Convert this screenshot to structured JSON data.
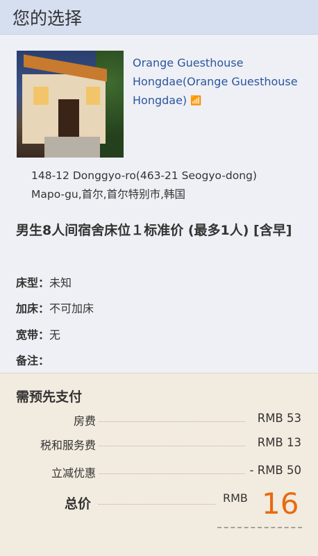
{
  "header": {
    "title": "您的选择"
  },
  "hotel": {
    "name": "Orange Guesthouse Hongdae(Orange Guesthouse Hongdae)",
    "wifi_icon": "wifi-icon",
    "address_line1": "148-12 Donggyo-ro(463-21 Seogyo-dong)",
    "address_line2": "Mapo-gu,首尔,首尔特别市,韩国"
  },
  "room": {
    "title": "男生8人间宿舍床位１标准价 (最多1人) [含早]",
    "details": [
      {
        "label": "床型：",
        "value": "未知"
      },
      {
        "label": "加床：",
        "value": "不可加床"
      },
      {
        "label": "宽带：",
        "value": "无"
      },
      {
        "label": "备注：",
        "value": ""
      }
    ]
  },
  "payment": {
    "title": "需预先支付",
    "rows": [
      {
        "label": "房费",
        "value": "RMB 53"
      },
      {
        "label": "税和服务费",
        "value": "RMB 13"
      },
      {
        "label": "立减优惠",
        "value": "- RMB 50"
      }
    ],
    "total_label": "总价",
    "total_currency": "RMB",
    "total_amount": "16"
  }
}
